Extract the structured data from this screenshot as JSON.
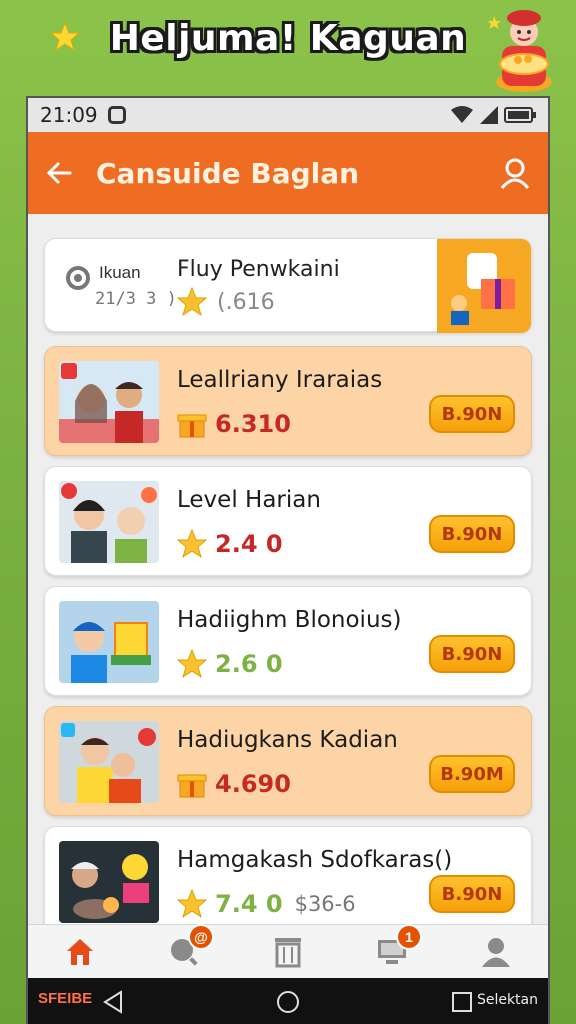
{
  "banner": {
    "title": "Heljuma! Kaguan"
  },
  "status_bar": {
    "time": "21:09"
  },
  "app_bar": {
    "title": "Cansuide Baglan"
  },
  "featured": {
    "label": "Ikuan",
    "sub": "21/3 3 )",
    "title": "Fluy Penwkaini",
    "rating": "(.616"
  },
  "items": [
    {
      "title": "Leallriany Iraraias",
      "score": "6.310",
      "score_color": "#c62828",
      "icon": "gift-icon",
      "button": "B.90N",
      "highlighted": true
    },
    {
      "title": "Level Harian",
      "score": "2.4 0",
      "score_color": "#c62828",
      "icon": "star-icon",
      "button": "B.90N",
      "highlighted": false
    },
    {
      "title": "Hadiighm Blonoius)",
      "score": "2.6 0",
      "score_color": "#7cb342",
      "icon": "star-icon",
      "button": "B.90N",
      "highlighted": false
    },
    {
      "title": "Hadiugkans Kadian",
      "score": "4.690",
      "score_color": "#c62828",
      "icon": "gift-icon",
      "button": "B.90M",
      "highlighted": true
    },
    {
      "title": "Hamgakash  Sdofkaras()",
      "score": "7.4 0",
      "extra": "$36-6",
      "score_color": "#7cb342",
      "icon": "star-icon",
      "button": "B.90N",
      "highlighted": false
    }
  ],
  "nav": {
    "items": [
      "home-icon",
      "search-icon",
      "trash-icon",
      "computer-icon",
      "profile-icon"
    ],
    "badges": {
      "search": "@",
      "computer": "1"
    }
  },
  "system_bar": {
    "left": "SFEIBE",
    "right": "Selektan"
  },
  "colors": {
    "accent": "#ef6c23",
    "button": "#f6a008",
    "highlight": "#fdd4a6"
  }
}
